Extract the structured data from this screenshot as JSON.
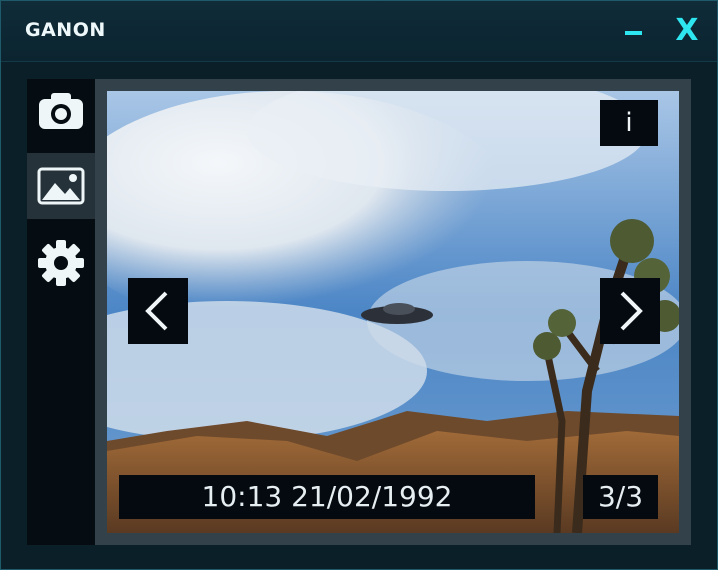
{
  "window": {
    "title": "GANON",
    "minimize_icon": "minimize-icon",
    "close_label": "X",
    "accent_color": "#2ee6f0"
  },
  "sidebar": {
    "items": [
      {
        "name": "camera",
        "icon": "camera-icon",
        "active": false
      },
      {
        "name": "gallery",
        "icon": "image-icon",
        "active": true
      },
      {
        "name": "settings",
        "icon": "gear-icon",
        "active": false
      }
    ]
  },
  "viewer": {
    "info_label": "i",
    "prev_icon": "chevron-left-icon",
    "next_icon": "chevron-right-icon",
    "timestamp": "10:13 21/02/1992",
    "counter": "3/3"
  }
}
